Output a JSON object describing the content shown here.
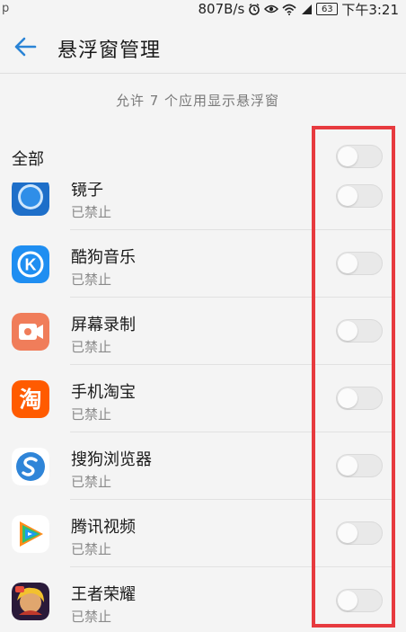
{
  "status_bar": {
    "left_icon": "p",
    "net_speed": "807B/s",
    "battery": "63",
    "time": "下午3:21",
    "icons": [
      "alarm-icon",
      "eye-icon",
      "wifi-icon",
      "signal-icon",
      "battery-icon"
    ]
  },
  "header": {
    "back_icon": "arrow-left-icon",
    "title": "悬浮窗管理"
  },
  "summary": "允许 7 个应用显示悬浮窗",
  "all": {
    "label": "全部",
    "enabled": false
  },
  "apps": [
    {
      "name": "镜子",
      "status": "已禁止",
      "icon": "mirror-app-icon",
      "enabled": false
    },
    {
      "name": "酷狗音乐",
      "status": "已禁止",
      "icon": "kugou-app-icon",
      "enabled": false
    },
    {
      "name": "屏幕录制",
      "status": "已禁止",
      "icon": "screen-record-app-icon",
      "enabled": false
    },
    {
      "name": "手机淘宝",
      "status": "已禁止",
      "icon": "taobao-app-icon",
      "enabled": false
    },
    {
      "name": "搜狗浏览器",
      "status": "已禁止",
      "icon": "sogou-browser-app-icon",
      "enabled": false
    },
    {
      "name": "腾讯视频",
      "status": "已禁止",
      "icon": "tencent-video-app-icon",
      "enabled": false
    },
    {
      "name": "王者荣耀",
      "status": "已禁止",
      "icon": "honor-of-kings-app-icon",
      "enabled": false
    }
  ],
  "icon_text": {
    "taobao": "淘",
    "kugou": "K"
  },
  "colors": {
    "accent": "#2a84d6",
    "highlight": "#e73a3f",
    "kugou": "#1f8ef1",
    "taobao": "#ff5b00",
    "screen_record": "#f07d5a",
    "sogou": "#2f85d8"
  }
}
